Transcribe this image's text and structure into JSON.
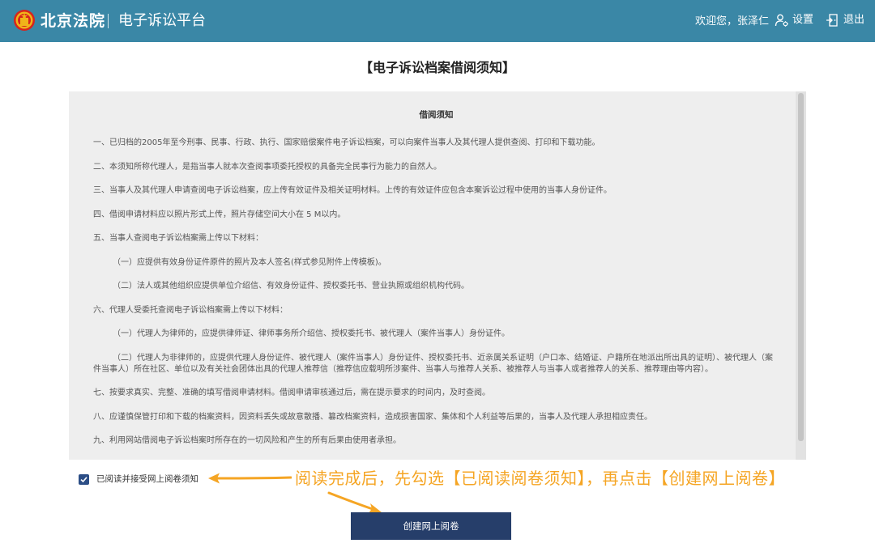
{
  "header": {
    "brand": "北京法院",
    "platform": "电子诉讼平台",
    "welcome": "欢迎您，张泽仁",
    "settings_label": "设置",
    "logout_label": "退出",
    "background_color": "#3a87a6"
  },
  "page": {
    "title": "【电子诉讼档案借阅须知】"
  },
  "notice": {
    "heading": "借阅须知",
    "paragraphs": [
      "一、已归档的2005年至今刑事、民事、行政、执行、国家赔偿案件电子诉讼档案，可以向案件当事人及其代理人提供查阅、打印和下载功能。",
      "二、本须知所称代理人，是指当事人就本次查阅事项委托授权的具备完全民事行为能力的自然人。",
      "三、当事人及其代理人申请查阅电子诉讼档案，应上传有效证件及相关证明材料。上传的有效证件应包含本案诉讼过程中使用的当事人身份证件。",
      "四、借阅申请材料应以照片形式上传，照片存储空间大小在 5 M以内。",
      "五、当事人查阅电子诉讼档案需上传以下材料：",
      "（一）应提供有效身份证件原件的照片及本人签名(样式参见附件上传模板)。",
      "（二）法人或其他组织应提供单位介绍信、有效身份证件、授权委托书、营业执照或组织机构代码。",
      "六、代理人受委托查阅电子诉讼档案需上传以下材料：",
      "（一）代理人为律师的，应提供律师证、律师事务所介绍信、授权委托书、被代理人（案件当事人）身份证件。",
      "（二）代理人为非律师的，应提供代理人身份证件、被代理人（案件当事人）身份证件、授权委托书、近亲属关系证明（户口本、结婚证、户籍所在地派出所出具的证明）、被代理人（案件当事人）所在社区、单位以及有关社会团体出具的代理人推荐信（推荐信应载明所涉案件、当事人与推荐人关系、被推荐人与当事人或者推荐人的关系、推荐理由等内容）。",
      "七、按要求真实、完整、准确的填写借阅申请材料。借阅申请审核通过后，需在提示要求的时间内，及时查阅。",
      "八、应谨慎保管打印和下载的档案资料，因资料丢失或故意散播、篡改档案资料，造成损害国家、集体和个人利益等后果的，当事人及代理人承担相应责任。",
      "九、利用网站借阅电子诉讼档案时所存在的一切风险和产生的所有后果由使用者承担。"
    ]
  },
  "agree": {
    "label": "已阅读并接受网上阅卷须知",
    "checked": true
  },
  "hint": {
    "text": "阅读完成后，先勾选【已阅读阅卷须知】，再点击【创建网上阅卷】",
    "color": "#f5a524"
  },
  "actions": {
    "create_label": "创建网上阅卷",
    "button_color": "#263e6a"
  },
  "icons": {
    "emblem": "court-emblem-icon",
    "settings": "user-gear-icon",
    "logout": "exit-door-icon",
    "check": "checkmark-icon",
    "arrows": "arrow-icon"
  }
}
